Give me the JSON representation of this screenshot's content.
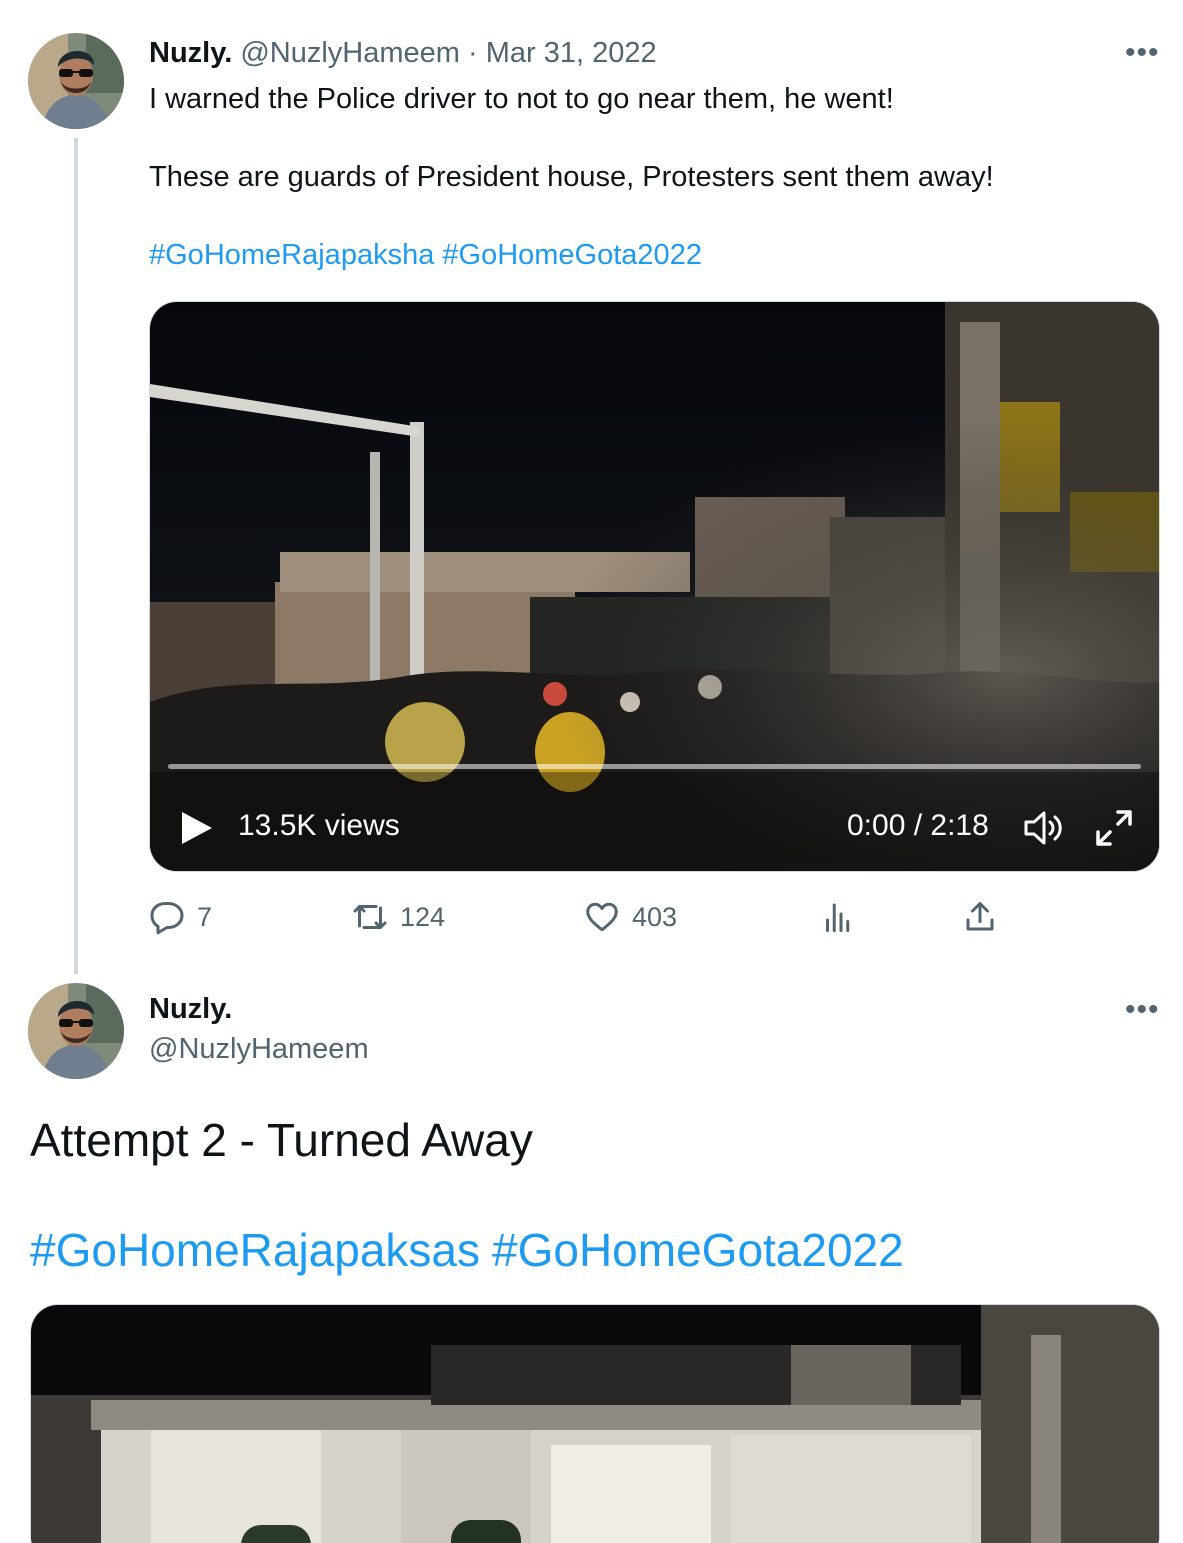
{
  "tweet1": {
    "author_name": "Nuzly.",
    "author_handle": "@NuzlyHameem",
    "separator": "·",
    "date": "Mar 31, 2022",
    "paragraph1": "I warned the Police driver to not to go near them, he went!",
    "paragraph2": "These are guards of President house, Protesters sent them away!",
    "hashtag1": "#GoHomeRajapaksha",
    "hashtag2": "#GoHomeGota2022",
    "more_icon": "more-horizontal-icon",
    "video": {
      "views": "13.5K views",
      "time": "0:00 / 2:18",
      "progress": 0
    },
    "actions": {
      "replies": "7",
      "retweets": "124",
      "likes": "403"
    }
  },
  "tweet2": {
    "author_name": "Nuzly.",
    "author_handle": "@NuzlyHameem",
    "text": "Attempt 2 - Turned Away",
    "hashtag1": "#GoHomeRajapaksas",
    "hashtag2": "#GoHomeGota2022",
    "more_icon": "more-horizontal-icon"
  },
  "colors": {
    "accent": "#1d9bf0",
    "muted": "#536471",
    "border": "#cfd9de"
  }
}
